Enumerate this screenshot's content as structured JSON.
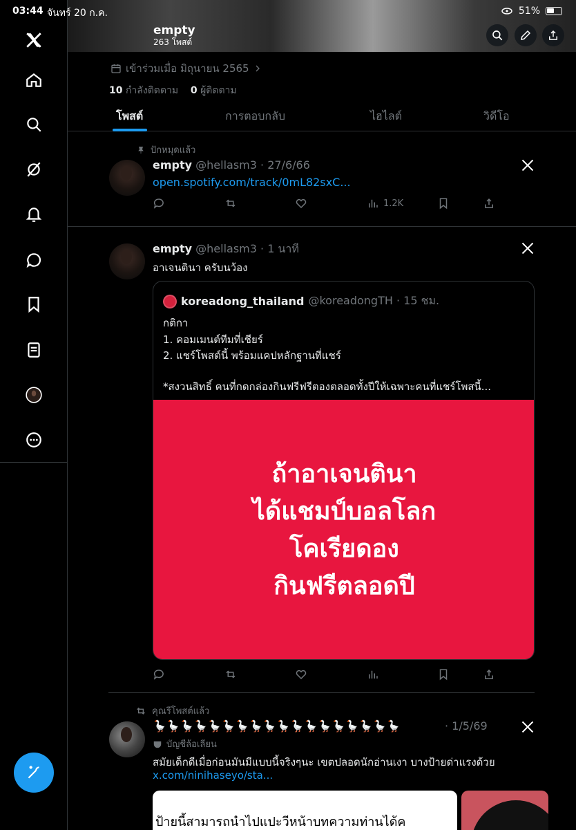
{
  "status_bar": {
    "time": "03:44",
    "date": "จันทร์ 20 ก.ค.",
    "battery": "51%"
  },
  "profile": {
    "name": "empty",
    "post_count": "263 โพสต์",
    "joined": "เข้าร่วมเมื่อ มิถุนายน 2565",
    "following_count": "10",
    "following_label": "กำลังติดตาม",
    "followers_count": "0",
    "followers_label": "ผู้ติดตาม"
  },
  "tabs": [
    "โพสต์",
    "การตอบกลับ",
    "ไฮไลต์",
    "วิดีโอ"
  ],
  "pinned_label": "ปักหมุดแล้ว",
  "post1": {
    "name": "empty",
    "handle": "@hellasm3 · 27/6/66",
    "link": "open.spotify.com/track/0mL82sxC...",
    "views": "1.2K"
  },
  "post2": {
    "name": "empty",
    "handle": "@hellasm3 · 1 นาที",
    "text": "อาเจนตินา ครับนว้อง",
    "quote": {
      "name": "koreadong_thailand",
      "handle": "@koreadongTH · 15 ชม.",
      "lines": [
        "กติกา",
        "1. คอมเมนต์ทีมที่เชียร์",
        "2. แชร์โพสต์นี้ พร้อมแคปหลักฐานที่แชร์",
        "*สงวนสิทธิ์ คนที่กดกล่องกินฟรีฟรีตองตลอดทั้งปีให้เฉพาะคนที่แชร์โพสนี้..."
      ],
      "image_lines": [
        "ถ้าอาเจนตินา",
        "ได้แชมป์บอลโลก",
        "โคเรียดอง",
        "กินฟรีตลอดปี"
      ],
      "image_color": "#e8163f"
    }
  },
  "repost_label": "คุณรีโพสต์แล้ว",
  "post3": {
    "name": "🪿🪿🪿🪿🪿🪿🪿🪿🪿🪿🪿🪿🪿🪿🪿🪿🪿🪿",
    "date": "· 1/5/69",
    "parody_label": "บัญชีล้อเลียน",
    "text": "สมัยเด็กดีเมื่อก่อนมันมีแบบนี้จริงๆนะ เขตปลอดนักอ่านเงา บางป้ายด่าแรงด้วย",
    "link": "x.com/ninihaseyo/sta...",
    "media_text": "ป้ายนี้สามารถนำไปแปะวีหน้าบทความท่านได้ค"
  },
  "colors": {
    "accent": "#1d9bf0",
    "background": "#000000",
    "muted": "#71767b",
    "border": "#2f3336"
  }
}
